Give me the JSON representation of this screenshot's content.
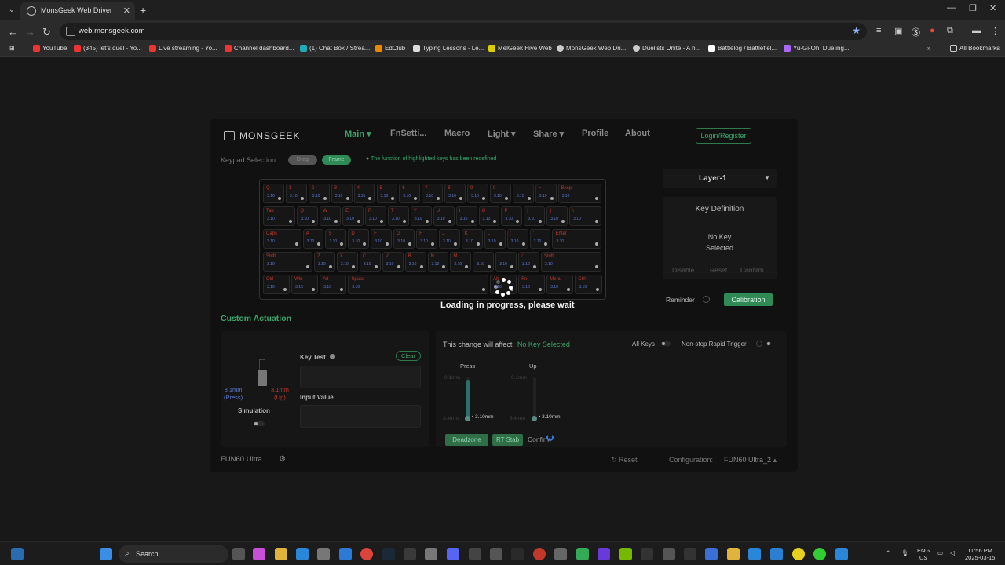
{
  "browser": {
    "tab_title": "MonsGeek Web Driver",
    "url": "web.monsgeek.com",
    "bookmarks": [
      "YouTube",
      "(345) let's duel - Yo...",
      "Live streaming - Yo...",
      "Channel dashboard...",
      "(1) Chat Box / Strea...",
      "EdClub",
      "Typing Lessons - Le...",
      "MelGeek Hive Web",
      "MonsGeek Web Dri...",
      "Duelists Unite - A h...",
      "Battlelog / Battlefiel...",
      "Yu-Gi-Oh! Dueling..."
    ],
    "all_bookmarks": "All Bookmarks"
  },
  "app": {
    "logo": "MONSGEEK",
    "menu": [
      "Main",
      "FnSetti...",
      "Macro",
      "Light",
      "Share",
      "Profile",
      "About"
    ],
    "login": "Login/Register",
    "keypad_label": "Keypad Selection",
    "pill_drag": "Drag",
    "pill_frame": "Frame",
    "redefined_note": "The function of highlighted keys has been redefined",
    "loading": "Loading in progress, please wait",
    "layer": "Layer-1",
    "key_definition": {
      "title": "Key Definition",
      "no_key_1": "No Key",
      "no_key_2": "Selected",
      "disable": "Disable",
      "reset": "Reset",
      "confirm": "Confirm"
    },
    "reminder": "Reminder",
    "calibration": "Calibration",
    "custom_actuation": "Custom Actuation",
    "left": {
      "press_mm": "3.1mm",
      "press_lbl": "(Press)",
      "up_mm": "3.1mm",
      "up_lbl": "(Up)",
      "simulation": "Simulation",
      "key_test": "Key Test",
      "clear": "Clear",
      "input_value": "Input Value"
    },
    "right": {
      "affect_label": "This change will affect:",
      "affect_value": "No Key Selected",
      "all_keys": "All Keys",
      "nonstop": "Non-stop Rapid Trigger",
      "press": "Press",
      "up": "Up",
      "top_val": "0.1mm",
      "bottom_val": "3.4mm",
      "press_value": "3.10mm",
      "up_value": "3.10mm",
      "deadzone": "Deadzone",
      "rt_stab": "RT Stab",
      "confirm": "Confirm"
    },
    "footer": {
      "model": "FUN60 Ultra",
      "reset": "Reset",
      "config_label": "Configuration:",
      "config_value": "FUN60 Ultra_2"
    }
  },
  "taskbar": {
    "search": "Search",
    "lang_1": "ENG",
    "lang_2": "US",
    "time": "11:56 PM",
    "date": "2025-03-15"
  },
  "keyboard_rows": [
    [
      "Q/Ω",
      "1/1",
      "2/2",
      "3/3",
      "4/4",
      "5/5",
      "6/6",
      "7/7",
      "8/8",
      "9/9",
      "0/0",
      "-/-",
      "=/=",
      "Bksp/Bksp"
    ],
    [
      "Tab/Tab",
      "Q/Q",
      "W/W",
      "E/E",
      "R/R",
      "T/T",
      "Y/Y",
      "U/U",
      "I/I",
      "O/O",
      "P/P",
      "[/[",
      "]/]",
      "\\/\\"
    ],
    [
      "Caps/Caps",
      "A/A",
      "S/S",
      "D/D",
      "F/F",
      "G/G",
      "H/H",
      "J/J",
      "K/K",
      "L/L",
      ";/;",
      "'/'",
      "Enter/Enter"
    ],
    [
      "Shift/Shift",
      "Z/Z",
      "X/X",
      "C/C",
      "V/V",
      "B/B",
      "N/N",
      "M/M",
      ",/,",
      "./.",
      "//",
      "Shift/Shift"
    ],
    [
      "Ctrl/Ctrl",
      "Win/Win",
      "Alt/Alt",
      "Space/Space",
      "Alt/Alt",
      "Fn/Fn",
      "Menu/Menu",
      "Ctrl/Ctrl"
    ]
  ]
}
